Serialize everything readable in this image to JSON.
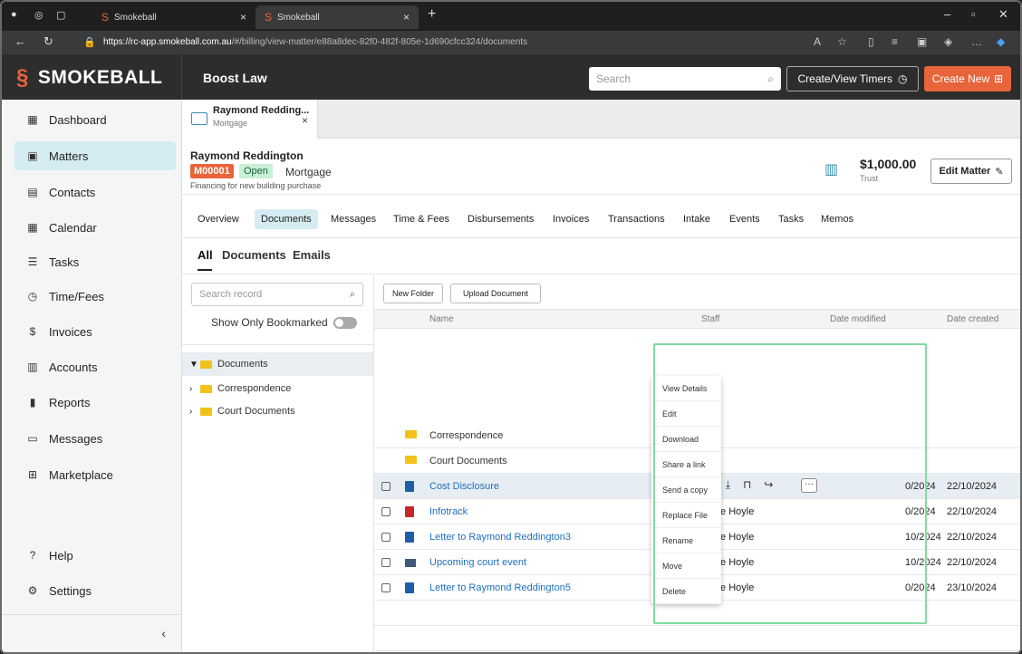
{
  "browser": {
    "tabs": [
      {
        "title": "Smokeball"
      },
      {
        "title": "Smokeball"
      }
    ],
    "url_host": "https://rc-app.smokeball.com.au",
    "url_path": "/#/billing/view-matter/e88a8dec-82f0-482f-805e-1d690cfcc324/documents"
  },
  "header": {
    "brand": "SMOKEBALL",
    "firm": "Boost Law",
    "search_placeholder": "Search",
    "timers_label": "Create/View Timers",
    "create_new_label": "Create New"
  },
  "sidebar": {
    "items": [
      {
        "label": "Dashboard",
        "icon": "dashboard-icon",
        "glyph": "▦"
      },
      {
        "label": "Matters",
        "icon": "matters-icon",
        "glyph": "▣"
      },
      {
        "label": "Contacts",
        "icon": "contacts-icon",
        "glyph": "▤"
      },
      {
        "label": "Calendar",
        "icon": "calendar-icon",
        "glyph": "▦"
      },
      {
        "label": "Tasks",
        "icon": "tasks-icon",
        "glyph": "☰"
      },
      {
        "label": "Time/Fees",
        "icon": "clock-icon",
        "glyph": "◷"
      },
      {
        "label": "Invoices",
        "icon": "invoice-icon",
        "glyph": "$"
      },
      {
        "label": "Accounts",
        "icon": "accounts-icon",
        "glyph": "▥"
      },
      {
        "label": "Reports",
        "icon": "reports-icon",
        "glyph": "▮"
      },
      {
        "label": "Messages",
        "icon": "messages-icon",
        "glyph": "▭"
      },
      {
        "label": "Marketplace",
        "icon": "marketplace-icon",
        "glyph": "⊞"
      },
      {
        "label": "Help",
        "icon": "help-icon",
        "glyph": "?"
      },
      {
        "label": "Settings",
        "icon": "settings-icon",
        "glyph": "⚙"
      }
    ],
    "collapse": "‹"
  },
  "open_tab": {
    "title": "Raymond Redding...",
    "subtitle": "Mortgage"
  },
  "matter": {
    "client": "Raymond Reddington",
    "number": "M00001",
    "status": "Open",
    "type": "Mortgage",
    "description": "Financing for new building purchase",
    "trust_amount": "$1,000.00",
    "trust_label": "Trust",
    "edit_label": "Edit Matter"
  },
  "subnav": [
    "Overview",
    "Documents",
    "Messages",
    "Time & Fees",
    "Disbursements",
    "Invoices",
    "Transactions",
    "Intake",
    "Events",
    "Tasks",
    "Memos"
  ],
  "doc_tabs": [
    "All",
    "Documents",
    "Emails"
  ],
  "folder_pane": {
    "search_placeholder": "Search record",
    "bookmark_label": "Show Only Bookmarked",
    "tree": [
      {
        "label": "Documents",
        "caret": "▼"
      },
      {
        "label": "Correspondence",
        "caret": "›"
      },
      {
        "label": "Court Documents",
        "caret": "›"
      }
    ]
  },
  "toolbar": {
    "new_folder": "New Folder",
    "upload": "Upload Document"
  },
  "columns": {
    "name": "Name",
    "staff": "Staff",
    "date_modified": "Date modified",
    "date_created": "Date created"
  },
  "rows": [
    {
      "name": "Correspondence",
      "kind": "folder"
    },
    {
      "name": "Court Documents",
      "kind": "folder"
    },
    {
      "name": "Cost Disclosure",
      "kind": "doc",
      "date_modified": "0/2024",
      "date_created": "22/10/2024"
    },
    {
      "name": "Infotrack",
      "kind": "pdf",
      "staff": "Adele Hoyle",
      "date_modified": "0/2024",
      "date_created": "22/10/2024"
    },
    {
      "name": "Letter to Raymond Reddington3",
      "kind": "doc",
      "staff": "Adele Hoyle",
      "date_modified": "10/2024",
      "date_created": "22/10/2024"
    },
    {
      "name": "Upcoming court event",
      "kind": "mail",
      "staff": "Adele Hoyle",
      "date_modified": "10/2024",
      "date_created": "22/10/2024"
    },
    {
      "name": "Letter to Raymond Reddington5",
      "kind": "doc",
      "staff": "Adele Hoyle",
      "date_modified": "0/2024",
      "date_created": "23/10/2024"
    }
  ],
  "context_menu": [
    "View Details",
    "Edit",
    "Download",
    "Share a link",
    "Send a copy",
    "Replace File",
    "Rename",
    "Move",
    "Delete"
  ],
  "colors": {
    "brand": "#e8643a",
    "selected_nav": "#d6ecf3",
    "link": "#1f6fc0",
    "highlight_box": "#7fdca2"
  }
}
